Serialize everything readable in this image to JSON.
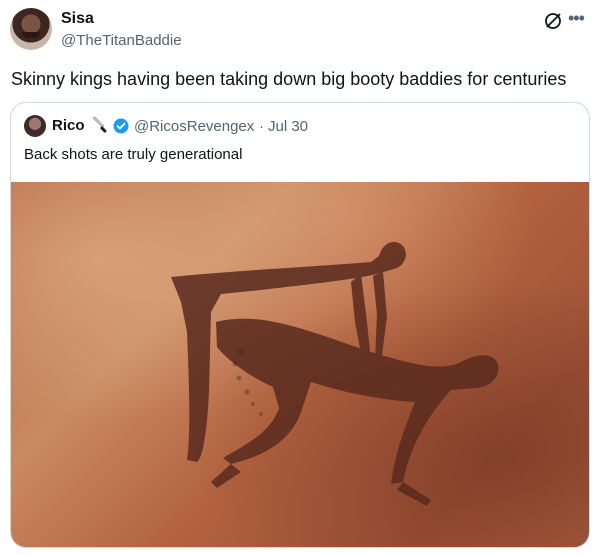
{
  "tweet": {
    "author_name": "Sisa",
    "author_handle": "@TheTitanBaddie",
    "text": "Skinny kings having been taking down big booty baddies for centuries",
    "more_icon": "more-icon",
    "grok_icon": "grok-icon"
  },
  "quoted": {
    "author_name": "Rico",
    "author_emoji": "knife-icon",
    "verified": true,
    "author_handle": "@RicosRevengex",
    "separator": "·",
    "date": "Jul 30",
    "text": "Back shots are truly generational",
    "image_description_icon": "cave-painting-image"
  },
  "colors": {
    "text": "#0f1419",
    "secondary": "#536471",
    "verified": "#1d9bf0",
    "border": "#cfd9de"
  }
}
